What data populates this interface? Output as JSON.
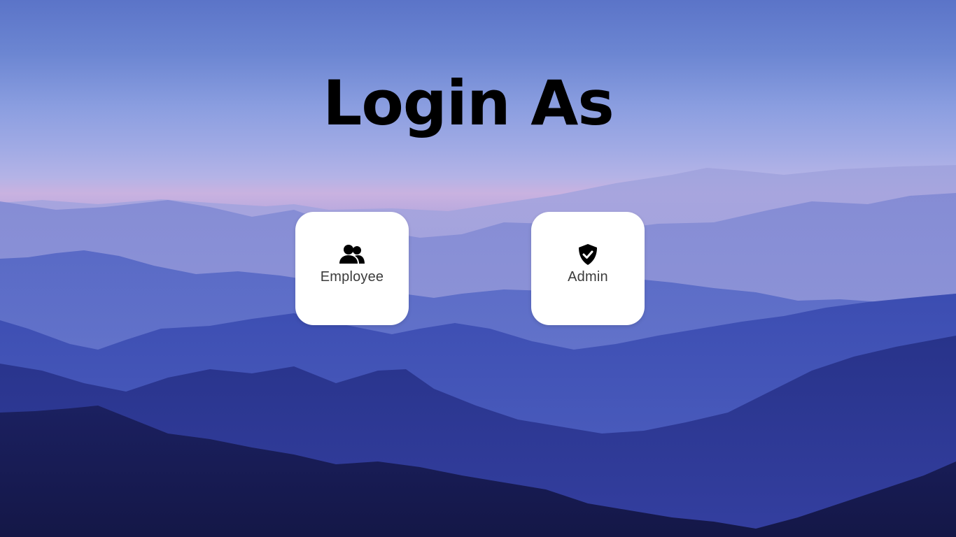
{
  "page": {
    "title": "Login As"
  },
  "roles": [
    {
      "label": "Employee",
      "icon": "users-icon"
    },
    {
      "label": "Admin",
      "icon": "shield-check-icon"
    }
  ],
  "colors": {
    "sky_top": "#5b74c8",
    "haze": "#c9b2e0",
    "mountain_dark": "#202a72",
    "card_background": "#ffffff",
    "title_text": "#000000",
    "label_text": "#3b3b3b"
  }
}
